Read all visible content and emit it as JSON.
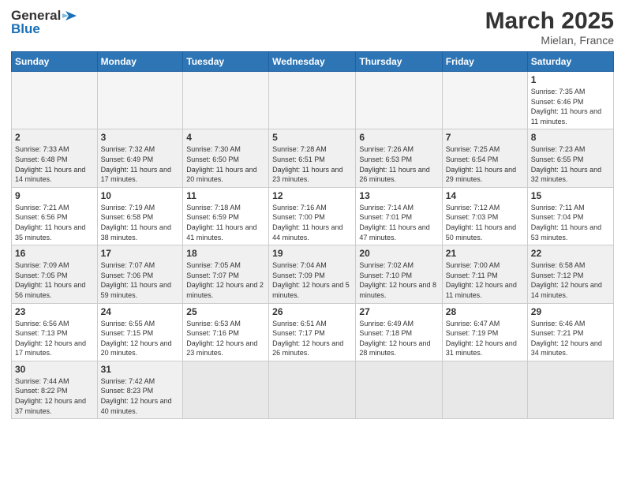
{
  "header": {
    "logo_general": "General",
    "logo_blue": "Blue",
    "month_year": "March 2025",
    "location": "Mielan, France"
  },
  "days_of_week": [
    "Sunday",
    "Monday",
    "Tuesday",
    "Wednesday",
    "Thursday",
    "Friday",
    "Saturday"
  ],
  "weeks": [
    {
      "shade": false,
      "days": [
        {
          "num": "",
          "info": ""
        },
        {
          "num": "",
          "info": ""
        },
        {
          "num": "",
          "info": ""
        },
        {
          "num": "",
          "info": ""
        },
        {
          "num": "",
          "info": ""
        },
        {
          "num": "",
          "info": ""
        },
        {
          "num": "1",
          "info": "Sunrise: 7:35 AM\nSunset: 6:46 PM\nDaylight: 11 hours and 11 minutes."
        }
      ]
    },
    {
      "shade": true,
      "days": [
        {
          "num": "2",
          "info": "Sunrise: 7:33 AM\nSunset: 6:48 PM\nDaylight: 11 hours and 14 minutes."
        },
        {
          "num": "3",
          "info": "Sunrise: 7:32 AM\nSunset: 6:49 PM\nDaylight: 11 hours and 17 minutes."
        },
        {
          "num": "4",
          "info": "Sunrise: 7:30 AM\nSunset: 6:50 PM\nDaylight: 11 hours and 20 minutes."
        },
        {
          "num": "5",
          "info": "Sunrise: 7:28 AM\nSunset: 6:51 PM\nDaylight: 11 hours and 23 minutes."
        },
        {
          "num": "6",
          "info": "Sunrise: 7:26 AM\nSunset: 6:53 PM\nDaylight: 11 hours and 26 minutes."
        },
        {
          "num": "7",
          "info": "Sunrise: 7:25 AM\nSunset: 6:54 PM\nDaylight: 11 hours and 29 minutes."
        },
        {
          "num": "8",
          "info": "Sunrise: 7:23 AM\nSunset: 6:55 PM\nDaylight: 11 hours and 32 minutes."
        }
      ]
    },
    {
      "shade": false,
      "days": [
        {
          "num": "9",
          "info": "Sunrise: 7:21 AM\nSunset: 6:56 PM\nDaylight: 11 hours and 35 minutes."
        },
        {
          "num": "10",
          "info": "Sunrise: 7:19 AM\nSunset: 6:58 PM\nDaylight: 11 hours and 38 minutes."
        },
        {
          "num": "11",
          "info": "Sunrise: 7:18 AM\nSunset: 6:59 PM\nDaylight: 11 hours and 41 minutes."
        },
        {
          "num": "12",
          "info": "Sunrise: 7:16 AM\nSunset: 7:00 PM\nDaylight: 11 hours and 44 minutes."
        },
        {
          "num": "13",
          "info": "Sunrise: 7:14 AM\nSunset: 7:01 PM\nDaylight: 11 hours and 47 minutes."
        },
        {
          "num": "14",
          "info": "Sunrise: 7:12 AM\nSunset: 7:03 PM\nDaylight: 11 hours and 50 minutes."
        },
        {
          "num": "15",
          "info": "Sunrise: 7:11 AM\nSunset: 7:04 PM\nDaylight: 11 hours and 53 minutes."
        }
      ]
    },
    {
      "shade": true,
      "days": [
        {
          "num": "16",
          "info": "Sunrise: 7:09 AM\nSunset: 7:05 PM\nDaylight: 11 hours and 56 minutes."
        },
        {
          "num": "17",
          "info": "Sunrise: 7:07 AM\nSunset: 7:06 PM\nDaylight: 11 hours and 59 minutes."
        },
        {
          "num": "18",
          "info": "Sunrise: 7:05 AM\nSunset: 7:07 PM\nDaylight: 12 hours and 2 minutes."
        },
        {
          "num": "19",
          "info": "Sunrise: 7:04 AM\nSunset: 7:09 PM\nDaylight: 12 hours and 5 minutes."
        },
        {
          "num": "20",
          "info": "Sunrise: 7:02 AM\nSunset: 7:10 PM\nDaylight: 12 hours and 8 minutes."
        },
        {
          "num": "21",
          "info": "Sunrise: 7:00 AM\nSunset: 7:11 PM\nDaylight: 12 hours and 11 minutes."
        },
        {
          "num": "22",
          "info": "Sunrise: 6:58 AM\nSunset: 7:12 PM\nDaylight: 12 hours and 14 minutes."
        }
      ]
    },
    {
      "shade": false,
      "days": [
        {
          "num": "23",
          "info": "Sunrise: 6:56 AM\nSunset: 7:13 PM\nDaylight: 12 hours and 17 minutes."
        },
        {
          "num": "24",
          "info": "Sunrise: 6:55 AM\nSunset: 7:15 PM\nDaylight: 12 hours and 20 minutes."
        },
        {
          "num": "25",
          "info": "Sunrise: 6:53 AM\nSunset: 7:16 PM\nDaylight: 12 hours and 23 minutes."
        },
        {
          "num": "26",
          "info": "Sunrise: 6:51 AM\nSunset: 7:17 PM\nDaylight: 12 hours and 26 minutes."
        },
        {
          "num": "27",
          "info": "Sunrise: 6:49 AM\nSunset: 7:18 PM\nDaylight: 12 hours and 28 minutes."
        },
        {
          "num": "28",
          "info": "Sunrise: 6:47 AM\nSunset: 7:19 PM\nDaylight: 12 hours and 31 minutes."
        },
        {
          "num": "29",
          "info": "Sunrise: 6:46 AM\nSunset: 7:21 PM\nDaylight: 12 hours and 34 minutes."
        }
      ]
    },
    {
      "shade": true,
      "days": [
        {
          "num": "30",
          "info": "Sunrise: 7:44 AM\nSunset: 8:22 PM\nDaylight: 12 hours and 37 minutes."
        },
        {
          "num": "31",
          "info": "Sunrise: 7:42 AM\nSunset: 8:23 PM\nDaylight: 12 hours and 40 minutes."
        },
        {
          "num": "",
          "info": ""
        },
        {
          "num": "",
          "info": ""
        },
        {
          "num": "",
          "info": ""
        },
        {
          "num": "",
          "info": ""
        },
        {
          "num": "",
          "info": ""
        }
      ]
    }
  ]
}
